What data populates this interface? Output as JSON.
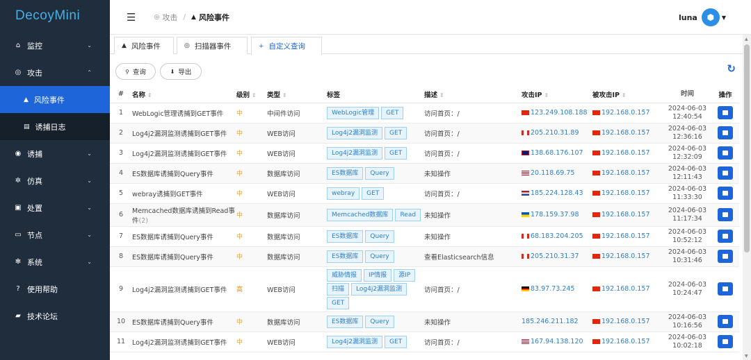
{
  "app": {
    "logo": "DecoyMini"
  },
  "sidebar": {
    "items": [
      {
        "label": "监控",
        "icon": "home-icon",
        "glyph": "⌂",
        "chev": "⌄"
      },
      {
        "label": "攻击",
        "icon": "target-icon",
        "glyph": "◎",
        "chev": "⌃"
      },
      {
        "label": "诱捕",
        "icon": "lure-icon",
        "glyph": "◉",
        "chev": "⌄"
      },
      {
        "label": "仿真",
        "icon": "gear-icon",
        "glyph": "✲",
        "chev": "⌄"
      },
      {
        "label": "处置",
        "icon": "toolbox-icon",
        "glyph": "▣",
        "chev": "⌄"
      },
      {
        "label": "节点",
        "icon": "monitor-icon",
        "glyph": "▭",
        "chev": "⌄"
      },
      {
        "label": "系统",
        "icon": "settings-icon",
        "glyph": "✻",
        "chev": "⌄"
      },
      {
        "label": "使用帮助",
        "icon": "help-icon",
        "glyph": "?",
        "chev": ""
      },
      {
        "label": "技术论坛",
        "icon": "forum-icon",
        "glyph": "▰",
        "chev": ""
      }
    ],
    "sub_items": [
      {
        "label": "风险事件",
        "icon": "bell-icon",
        "glyph": "▲"
      },
      {
        "label": "诱捕日志",
        "icon": "log-icon",
        "glyph": "▤"
      }
    ]
  },
  "topbar": {
    "breadcrumb_parent": "攻击",
    "breadcrumb_current": "风险事件",
    "sep": "/",
    "username": "luna"
  },
  "tabs": [
    {
      "label": "风险事件",
      "glyph": "▲"
    },
    {
      "label": "扫描器事件",
      "glyph": "◎"
    },
    {
      "label": "自定义查询",
      "glyph": "+"
    }
  ],
  "toolbar": {
    "query_label": "查询",
    "export_label": "导出"
  },
  "table": {
    "headers": {
      "num": "#",
      "name": "名称",
      "level": "级别",
      "type": "类型",
      "tags": "标签",
      "desc": "描述",
      "attacker_ip": "攻击IP",
      "target_ip": "被攻击IP",
      "time": "时间",
      "op": "操作"
    },
    "rows": [
      {
        "num": "1",
        "name": "WebLogic管理诱捕到GET事件",
        "sub": "",
        "level": "中",
        "type": "中间件访问",
        "tags": [
          "WebLogic管理",
          "GET"
        ],
        "desc": "访问首页：/",
        "attacker_ip": "123.249.108.188",
        "attacker_flag": "cn",
        "target_ip": "192.168.0.157",
        "date": "2024-06-03",
        "time": "12:40:54"
      },
      {
        "num": "2",
        "name": "Log4j2漏洞监测诱捕到GET事件",
        "sub": "",
        "level": "中",
        "type": "WEB访问",
        "tags": [
          "Log4j2漏洞监测",
          "GET"
        ],
        "desc": "访问首页：/",
        "attacker_ip": "205.210.31.89",
        "attacker_flag": "ca",
        "target_ip": "192.168.0.157",
        "date": "2024-06-03",
        "time": "12:36:16"
      },
      {
        "num": "3",
        "name": "Log4j2漏洞监测诱捕到GET事件",
        "sub": "",
        "level": "中",
        "type": "WEB访问",
        "tags": [
          "Log4j2漏洞监测",
          "GET"
        ],
        "desc": "访问首页：/",
        "attacker_ip": "138.68.176.107",
        "attacker_flag": "gb",
        "target_ip": "192.168.0.157",
        "date": "2024-06-03",
        "time": "12:32:09"
      },
      {
        "num": "4",
        "name": "ES数据库诱捕到Query事件",
        "sub": "",
        "level": "中",
        "type": "数据库访问",
        "tags": [
          "ES数据库",
          "Query"
        ],
        "desc": "未知操作",
        "attacker_ip": "20.118.69.75",
        "attacker_flag": "us",
        "target_ip": "192.168.0.157",
        "date": "2024-06-03",
        "time": "12:11:43"
      },
      {
        "num": "5",
        "name": "webray诱捕到GET事件",
        "sub": "",
        "level": "中",
        "type": "WEB访问",
        "tags": [
          "webray",
          "GET"
        ],
        "desc": "访问首页：/",
        "attacker_ip": "185.224.128.43",
        "attacker_flag": "nl",
        "target_ip": "192.168.0.157",
        "date": "2024-06-03",
        "time": "11:33:30"
      },
      {
        "num": "6",
        "name": "Memcached数据库诱捕到Read事件",
        "sub": "(2)",
        "level": "中",
        "type": "数据库访问",
        "tags": [
          "Memcached数据库",
          "Read"
        ],
        "desc": "未知操作",
        "attacker_ip": "178.159.37.98",
        "attacker_flag": "ua",
        "target_ip": "192.168.0.157",
        "date": "2024-06-03",
        "time": "11:17:34"
      },
      {
        "num": "7",
        "name": "ES数据库诱捕到Query事件",
        "sub": "",
        "level": "中",
        "type": "数据库访问",
        "tags": [
          "ES数据库",
          "Query"
        ],
        "desc": "未知操作",
        "attacker_ip": "68.183.204.205",
        "attacker_flag": "ca",
        "target_ip": "192.168.0.157",
        "date": "2024-06-03",
        "time": "10:52:12"
      },
      {
        "num": "8",
        "name": "ES数据库诱捕到Query事件",
        "sub": "",
        "level": "中",
        "type": "数据库访问",
        "tags": [
          "ES数据库",
          "Query"
        ],
        "desc": "查看Elasticsearch信息",
        "attacker_ip": "205.210.31.37",
        "attacker_flag": "ca",
        "target_ip": "192.168.0.157",
        "date": "2024-06-03",
        "time": "10:31:46"
      },
      {
        "num": "9",
        "name": "Log4j2漏洞监测诱捕到GET事件",
        "sub": "",
        "level": "高",
        "type": "WEB访问",
        "tags": [
          "威胁情报",
          "IP情报",
          "源IP",
          "扫描",
          "Log4j2漏洞监测",
          "GET"
        ],
        "desc": "访问首页：/",
        "attacker_ip": "83.97.73.245",
        "attacker_flag": "de",
        "target_ip": "192.168.0.157",
        "date": "2024-06-03",
        "time": "10:24:47"
      },
      {
        "num": "10",
        "name": "ES数据库诱捕到Query事件",
        "sub": "",
        "level": "中",
        "type": "数据库访问",
        "tags": [
          "ES数据库",
          "Query"
        ],
        "desc": "未知操作",
        "attacker_ip": "185.246.211.182",
        "attacker_flag": "",
        "target_ip": "192.168.0.157",
        "date": "2024-06-03",
        "time": "10:16:56"
      },
      {
        "num": "11",
        "name": "Log4j2漏洞监测诱捕到GET事件",
        "sub": "",
        "level": "中",
        "type": "WEB访问",
        "tags": [
          "Log4j2漏洞监测",
          "GET"
        ],
        "desc": "访问首页：/",
        "attacker_ip": "167.94.138.120",
        "attacker_flag": "us",
        "target_ip": "192.168.0.157",
        "date": "2024-06-03",
        "time": "10:02:18"
      }
    ]
  },
  "colors": {
    "sidebar_bg": "#1f2d3d",
    "accent": "#1d65d8",
    "tag_border": "#9fd0ef",
    "level_mid": "#f0a020"
  }
}
